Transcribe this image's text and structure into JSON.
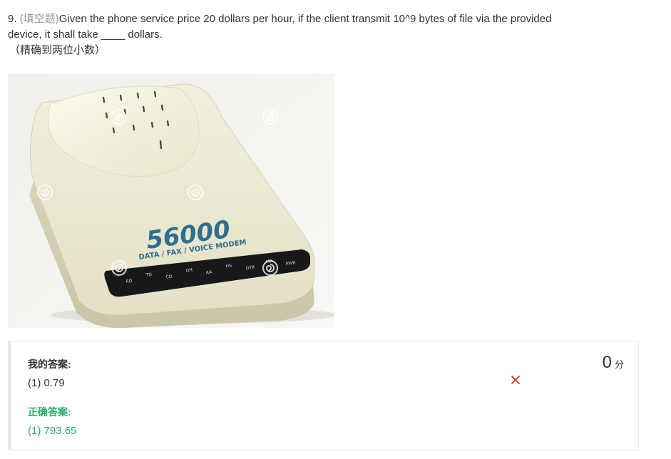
{
  "question": {
    "number": "9. ",
    "type_tag": "(填空题)",
    "text_line1": "Given the phone service price 20 dollars per hour, if the client transmit 10^9 bytes of file via the provided",
    "text_line2": "device, it shall take ____ dollars.",
    "precision_note": "（精确到两位小数）"
  },
  "image": {
    "brand_number": "56000",
    "subtitle": "DATA / FAX / VOICE MODEM",
    "panel_labels": [
      "RD",
      "TD",
      "CD",
      "OH",
      "AA",
      "HS",
      "DTR",
      "MR",
      "PWR"
    ],
    "watermark_icon": "dreamstime-swirl-icon"
  },
  "answer": {
    "my_answer_title": "我的答案:",
    "my_answer_value": "(1) 0.79",
    "result_icon": "wrong-x-icon",
    "result_color": "#e8453c",
    "score": "0",
    "score_unit": "分",
    "correct_title": "正确答案:",
    "correct_value": "(1) 793.65",
    "correct_color": "#2bab67"
  }
}
